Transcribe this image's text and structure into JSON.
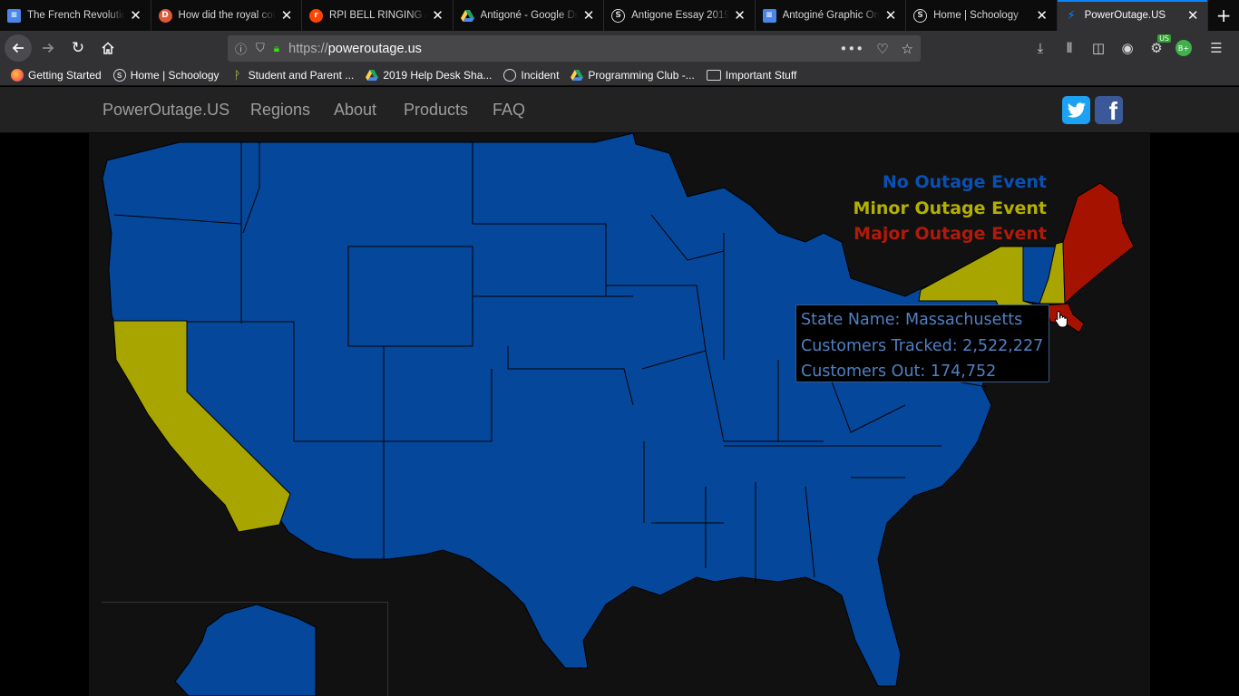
{
  "browser": {
    "tabs": [
      {
        "title": "The French Revolution",
        "favicon": "doc-icon",
        "active": false
      },
      {
        "title": "How did the royal court",
        "favicon": "duckduckgo-icon",
        "active": false
      },
      {
        "title": "RPI BELL RINGING AMA",
        "favicon": "reddit-icon",
        "active": false
      },
      {
        "title": "Antigoné - Google Drive",
        "favicon": "drive-icon",
        "active": false
      },
      {
        "title": "Antigone Essay 2019",
        "favicon": "schoology-icon",
        "active": false
      },
      {
        "title": "Antoginé Graphic Organizer",
        "favicon": "doc-icon",
        "active": false
      },
      {
        "title": "Home | Schoology",
        "favicon": "schoology-icon",
        "active": false
      },
      {
        "title": "PowerOutage.US",
        "favicon": "bolt-icon",
        "active": true
      }
    ],
    "url_prefix": "https://",
    "url_host": "poweroutage.us",
    "bookmarks": [
      {
        "label": "Getting Started",
        "icon": "firefox-icon"
      },
      {
        "label": "Home | Schoology",
        "icon": "schoology-icon"
      },
      {
        "label": "Student and Parent ...",
        "icon": "pin-icon"
      },
      {
        "label": "2019 Help Desk Sha...",
        "icon": "drive-icon"
      },
      {
        "label": "Incident",
        "icon": "globe-icon"
      },
      {
        "label": "Programming Club -...",
        "icon": "drive-icon"
      },
      {
        "label": "Important Stuff",
        "icon": "folder-icon"
      }
    ],
    "extension_badge": "US",
    "extension_green_label": "B+"
  },
  "site": {
    "brand": "PowerOutage.US",
    "nav": [
      "Regions",
      "About",
      "Products",
      "FAQ"
    ]
  },
  "legend": {
    "no_outage": "No Outage Event",
    "minor_outage": "Minor Outage Event",
    "major_outage": "Major Outage Event"
  },
  "tooltip": {
    "state_name": "State Name: Massachusetts",
    "customers_tracked": "Customers Tracked: 2,522,227",
    "customers_out": "Customers Out: 174,752"
  },
  "colors": {
    "no_outage": "#05479A",
    "minor_outage": "#A8A500",
    "major_outage": "#A51300",
    "legend_no": "#0A50B4",
    "legend_minor": "#B3B000",
    "legend_major": "#B01A0A"
  },
  "state_status": {
    "California": "minor",
    "New York": "minor",
    "New Hampshire": "minor",
    "Maine": "major",
    "Massachusetts": "major",
    "Vermont": "none"
  }
}
